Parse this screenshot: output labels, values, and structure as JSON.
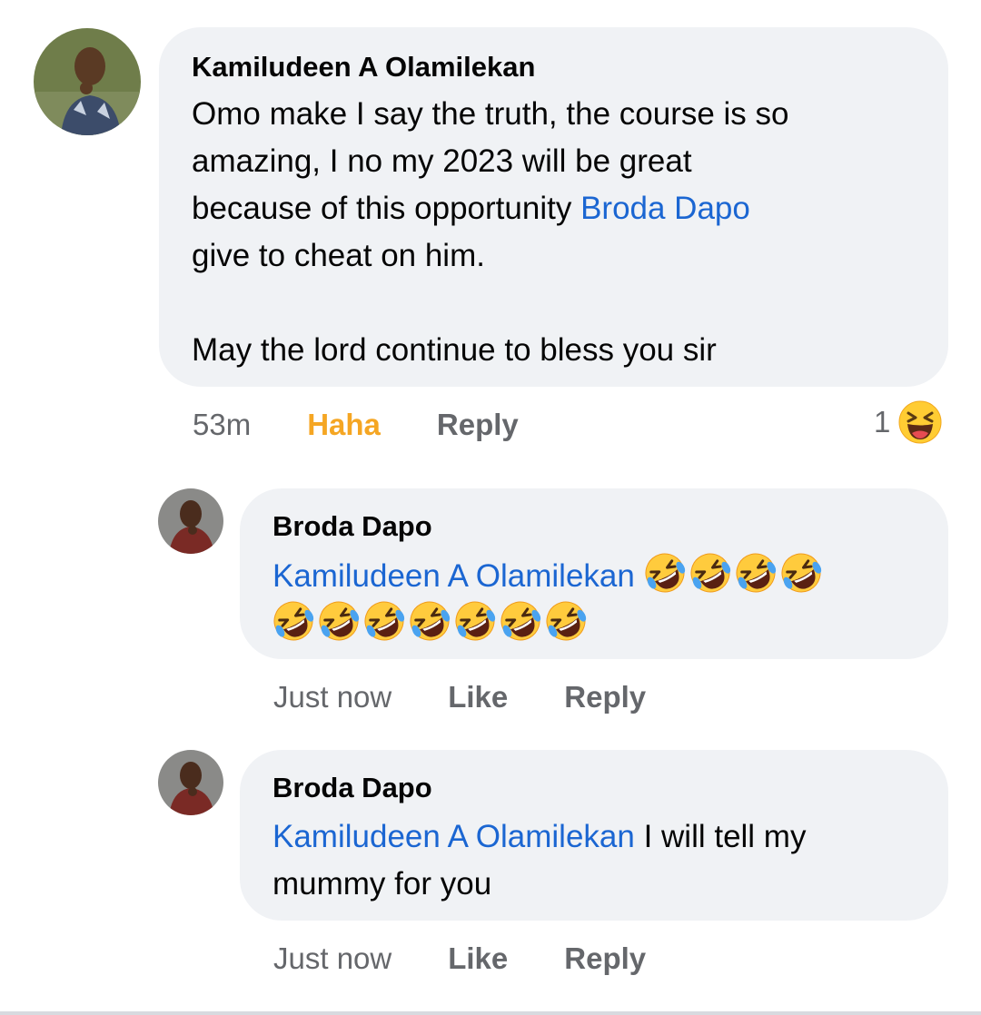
{
  "comments": [
    {
      "author": "Kamiludeen A Olamilekan",
      "text_lines": [
        "Omo make I say the truth, the course is so",
        "amazing, I no my 2023 will be great",
        "because of this opportunity ",
        "give to cheat on him.",
        "",
        "May the lord continue to bless you sir"
      ],
      "inline_mention": "Broda Dapo",
      "time": "53m",
      "reaction_label": "Haha",
      "reply_label": "Reply",
      "reaction_count": "1",
      "reaction_icon": "laughing-squinting-face-icon"
    }
  ],
  "replies": [
    {
      "author": "Broda Dapo",
      "mention": "Kamiludeen A Olamilekan",
      "text": "",
      "emoji_count": 11,
      "emoji_icon": "rolling-on-floor-laughing-icon",
      "time": "Just now",
      "like_label": "Like",
      "reply_label": "Reply"
    },
    {
      "author": "Broda Dapo",
      "mention": "Kamiludeen A Olamilekan",
      "text_line1": " I will tell my",
      "text_line2": "mummy for you",
      "time": "Just now",
      "like_label": "Like",
      "reply_label": "Reply"
    }
  ],
  "colors": {
    "bubble": "#f0f2f5",
    "mention": "#1b66d2",
    "meta": "#65676b",
    "haha": "#f5a623"
  }
}
